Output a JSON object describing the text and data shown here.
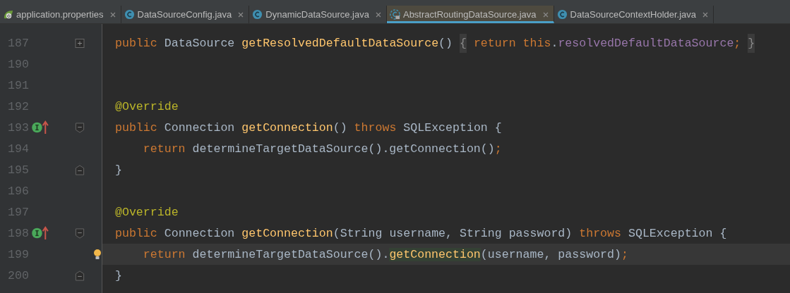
{
  "tabs": [
    {
      "label": "application.properties",
      "kind": "spring",
      "selected": false
    },
    {
      "label": "DataSourceConfig.java",
      "kind": "class",
      "selected": false
    },
    {
      "label": "DynamicDataSource.java",
      "kind": "class",
      "selected": false
    },
    {
      "label": "AbstractRoutingDataSource.java",
      "kind": "abstract",
      "selected": true
    },
    {
      "label": "DataSourceContextHolder.java",
      "kind": "class",
      "selected": false
    }
  ],
  "lines": [
    {
      "number": "187",
      "kind": "folded",
      "override": false,
      "current": false,
      "bulb": false,
      "tokens": [
        {
          "text": "public ",
          "kind": "keyword"
        },
        {
          "text": "DataSource ",
          "kind": "plain"
        },
        {
          "text": "getResolvedDefaultDataSource",
          "kind": "method"
        },
        {
          "text": "() ",
          "kind": "plain"
        },
        {
          "text": "{",
          "kind": "foldbrace"
        },
        {
          "text": " return this",
          "kind": "keyword"
        },
        {
          "text": ".",
          "kind": "plain"
        },
        {
          "text": "resolvedDefaultDataSource",
          "kind": "field"
        },
        {
          "text": "; ",
          "kind": "keyword"
        },
        {
          "text": "}",
          "kind": "foldbrace"
        }
      ]
    },
    {
      "number": "190",
      "kind": "plain",
      "override": false,
      "current": false,
      "bulb": false
    },
    {
      "number": "191",
      "kind": "plain",
      "override": false,
      "current": false,
      "bulb": false
    },
    {
      "number": "192",
      "kind": "plain",
      "override": false,
      "current": false,
      "bulb": false,
      "tokens": [
        {
          "text": "@Override",
          "kind": "annotation"
        }
      ]
    },
    {
      "number": "193",
      "kind": "block-start",
      "override": true,
      "current": false,
      "bulb": false,
      "tokens": [
        {
          "text": "public ",
          "kind": "keyword"
        },
        {
          "text": "Connection ",
          "kind": "plain"
        },
        {
          "text": "getConnection",
          "kind": "method"
        },
        {
          "text": "() ",
          "kind": "plain"
        },
        {
          "text": "throws ",
          "kind": "keyword"
        },
        {
          "text": "SQLException {",
          "kind": "plain"
        }
      ]
    },
    {
      "number": "194",
      "kind": "plain",
      "override": false,
      "current": false,
      "bulb": false,
      "tokens": [
        {
          "text": "    return ",
          "kind": "keyword"
        },
        {
          "text": "determineTargetDataSource().getConnection()",
          "kind": "plain"
        },
        {
          "text": ";",
          "kind": "keyword"
        }
      ]
    },
    {
      "number": "195",
      "kind": "block-end",
      "override": false,
      "current": false,
      "bulb": false,
      "tokens": [
        {
          "text": "}",
          "kind": "plain"
        }
      ]
    },
    {
      "number": "196",
      "kind": "plain",
      "override": false,
      "current": false,
      "bulb": false
    },
    {
      "number": "197",
      "kind": "plain",
      "override": false,
      "current": false,
      "bulb": false,
      "tokens": [
        {
          "text": "@Override",
          "kind": "annotation"
        }
      ]
    },
    {
      "number": "198",
      "kind": "block-start",
      "override": true,
      "current": false,
      "bulb": false,
      "tokens": [
        {
          "text": "public ",
          "kind": "keyword"
        },
        {
          "text": "Connection ",
          "kind": "plain"
        },
        {
          "text": "getConnection",
          "kind": "method"
        },
        {
          "text": "(String username, String password) ",
          "kind": "plain"
        },
        {
          "text": "throws ",
          "kind": "keyword"
        },
        {
          "text": "SQLException {",
          "kind": "plain"
        }
      ]
    },
    {
      "number": "199",
      "kind": "plain",
      "override": false,
      "current": true,
      "bulb": true,
      "tokens": [
        {
          "text": "    return ",
          "kind": "keyword"
        },
        {
          "text": "determineTargetDataSource().",
          "kind": "plain"
        },
        {
          "text": "getConnection",
          "kind": "usage"
        },
        {
          "text": "(username, password)",
          "kind": "plain"
        },
        {
          "text": ";",
          "kind": "keyword"
        }
      ]
    },
    {
      "number": "200",
      "kind": "block-end",
      "override": false,
      "current": false,
      "bulb": false,
      "tokens": [
        {
          "text": "}",
          "kind": "plain"
        }
      ]
    }
  ]
}
